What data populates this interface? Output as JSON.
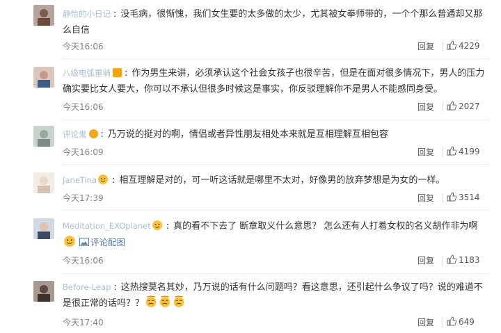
{
  "comments": [
    {
      "user": "静怡的小日记",
      "text": "没毛病，很惭愧，我们女生要的太多做的太少，尤其被女拳师带的，一个个那么普通却又那么自信",
      "time": "今天16:06",
      "reply": "回复",
      "likes": "4229",
      "badge": "none",
      "avatar_color": "#7d5a50"
    },
    {
      "user": "八级电弧重骑",
      "text": "作为男生来讲，必须承认这个社会女孩子也很辛苦，但是在面对很多情况下，男人的压力确实要比女人要大，你可以不承认但很多时候这是事实，你反驳理解你不是男人不能感同身受。",
      "time": "今天16:06",
      "reply": "回复",
      "likes": "2027",
      "badge": "vip",
      "avatar_color": "#c79a86"
    },
    {
      "user": "评论鬼",
      "text": "乃万说的挺对的啊，情侣或者异性朋友相处本来就是互相理解互相包容",
      "time": "今天16:09",
      "reply": "回复",
      "likes": "4199",
      "badge": "gold",
      "avatar_color": "#9aa7a0"
    },
    {
      "user": "JaneTina",
      "text": "相互理解是对的，可一听这话就是哪里不太对，好像男的放弃梦想是为女的一样。",
      "time": "今天17:39",
      "reply": "回复",
      "likes": "3514",
      "badge": "emoji",
      "avatar_color": "#e8d9c8"
    },
    {
      "user": "Meditation_EXOplanet",
      "text": "真的看不下去了 断章取义什么意思？ 怎么还有人打着女权的名义胡作非为啊",
      "pic_link": "评论配图",
      "time": "今天16:06",
      "reply": "回复",
      "likes": "1183",
      "badge": "emoji",
      "avatar_color": "#3c4a66"
    },
    {
      "user": "Before-Leap",
      "text": "这热搜莫名其妙，乃万说的话有什么问题吗？看这意思，还引起什么争议了吗？说的难道不是很正常的话吗？？",
      "time": "今天17:40",
      "reply": "回复",
      "likes": "649",
      "badge": "none",
      "avatar_color": "#5c4a42"
    }
  ]
}
